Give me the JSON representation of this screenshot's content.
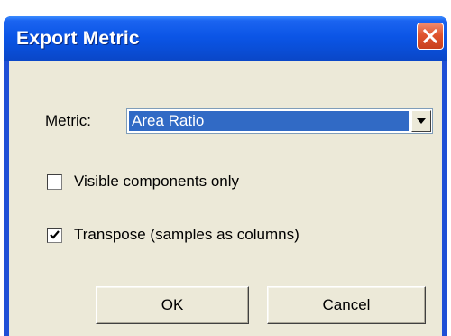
{
  "dialog": {
    "title": "Export Metric",
    "metric_label": "Metric:",
    "metric_selected": "Area Ratio",
    "visible_only_label": "Visible components only",
    "visible_only_checked": false,
    "transpose_label": "Transpose (samples as columns)",
    "transpose_checked": true,
    "ok_label": "OK",
    "cancel_label": "Cancel"
  },
  "colors": {
    "titlebar": "#0a4fd9",
    "client": "#ece9d8",
    "selection": "#316ac5",
    "close": "#e0542e"
  },
  "icons": {
    "close": "close-icon",
    "dropdown": "chevron-down-icon",
    "check": "checkmark-icon"
  }
}
